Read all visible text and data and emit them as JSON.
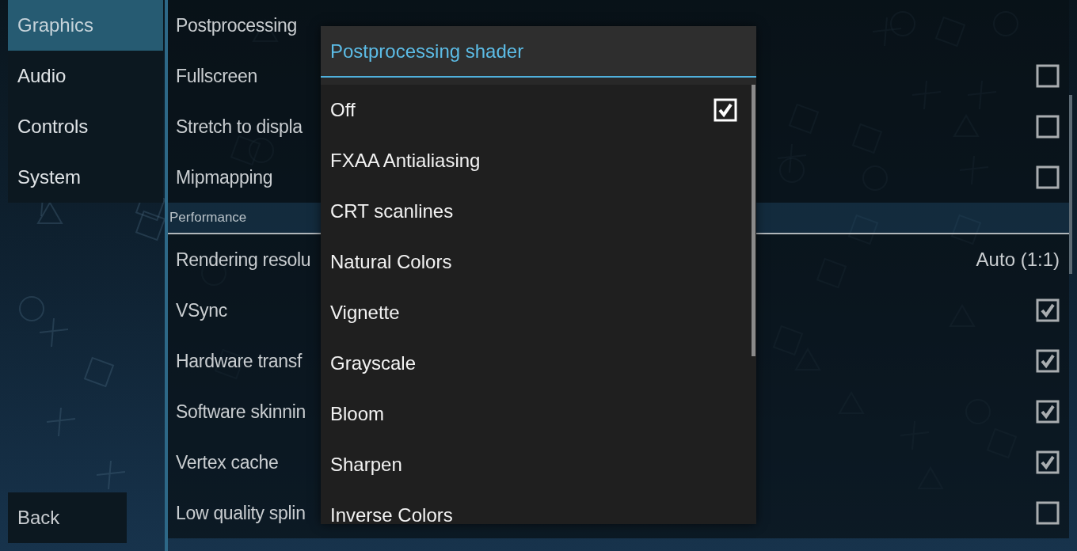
{
  "sidebar": {
    "items": [
      {
        "label": "Graphics",
        "selected": true
      },
      {
        "label": "Audio",
        "selected": false
      },
      {
        "label": "Controls",
        "selected": false
      },
      {
        "label": "System",
        "selected": false
      }
    ],
    "back_button": "Back"
  },
  "settings": {
    "sections": [
      {
        "rows": [
          {
            "label": "Postprocessing",
            "kind": "plain"
          },
          {
            "label": "Fullscreen",
            "kind": "checkbox",
            "checked": false
          },
          {
            "label": "Stretch to displa",
            "kind": "checkbox",
            "checked": false
          },
          {
            "label": "Mipmapping",
            "kind": "checkbox",
            "checked": false
          }
        ]
      },
      {
        "header": "Performance",
        "rows": [
          {
            "label": "Rendering resolu",
            "kind": "value",
            "value": "Auto (1:1)"
          },
          {
            "label": "VSync",
            "kind": "checkbox",
            "checked": true
          },
          {
            "label": "Hardware transf",
            "kind": "checkbox",
            "checked": true
          },
          {
            "label": "Software skinnin",
            "kind": "checkbox",
            "checked": true
          },
          {
            "label": "Vertex cache",
            "kind": "checkbox",
            "checked": true
          },
          {
            "label": "Low quality splin",
            "kind": "checkbox",
            "checked": false
          }
        ]
      }
    ]
  },
  "dialog": {
    "title": "Postprocessing shader",
    "options": [
      {
        "label": "Off",
        "selected": true
      },
      {
        "label": "FXAA Antialiasing",
        "selected": false
      },
      {
        "label": "CRT scanlines",
        "selected": false
      },
      {
        "label": "Natural Colors",
        "selected": false
      },
      {
        "label": "Vignette",
        "selected": false
      },
      {
        "label": "Grayscale",
        "selected": false
      },
      {
        "label": "Bloom",
        "selected": false
      },
      {
        "label": "Sharpen",
        "selected": false
      },
      {
        "label": "Inverse Colors",
        "selected": false
      }
    ]
  }
}
